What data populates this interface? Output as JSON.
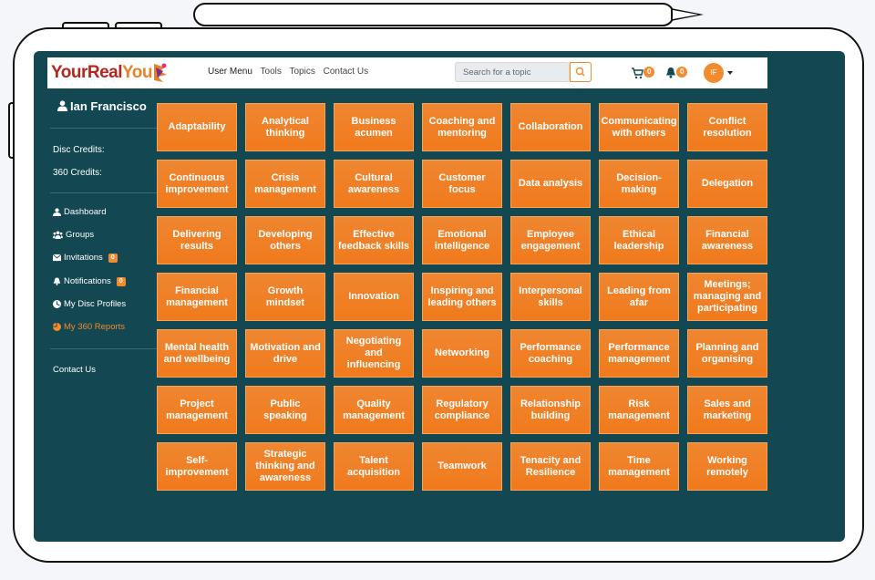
{
  "brand": {
    "part1": "YourReal",
    "part2": "You"
  },
  "nav": {
    "items": [
      "User Menu",
      "Tools",
      "Topics",
      "Contact Us"
    ]
  },
  "search": {
    "placeholder": "Search for a topic"
  },
  "header": {
    "cart_count": "0",
    "notification_count": "0",
    "avatar_initials": "IF"
  },
  "sidebar": {
    "user_name": "Ian Francisco",
    "disc_credits_label": "Disc Credits:",
    "credits360_label": "360 Credits:",
    "menu": [
      {
        "label": "Dashboard",
        "icon": "user-icon"
      },
      {
        "label": "Groups",
        "icon": "users-icon"
      },
      {
        "label": "Invitations",
        "icon": "envelope-icon",
        "badge": "0"
      },
      {
        "label": "Notifications",
        "icon": "bell-icon",
        "badge": "0"
      },
      {
        "label": "My Disc Profiles",
        "icon": "disc-icon"
      },
      {
        "label": "My 360 Reports",
        "icon": "pie-chart-icon",
        "active": true
      }
    ],
    "contact_label": "Contact Us"
  },
  "topics": [
    "Adaptability",
    "Analytical thinking",
    "Business acumen",
    "Coaching and mentoring",
    "Collaboration",
    "Communicating with others",
    "Conflict resolution",
    "Continuous improvement",
    "Crisis management",
    "Cultural awareness",
    "Customer focus",
    "Data analysis",
    "Decision-making",
    "Delegation",
    "Delivering results",
    "Developing others",
    "Effective feedback skills",
    "Emotional intelligence",
    "Employee engagement",
    "Ethical leadership",
    "Financial awareness",
    "Financial management",
    "Growth mindset",
    "Innovation",
    "Inspiring and leading others",
    "Interpersonal skills",
    "Leading from afar",
    "Meetings; managing and participating",
    "Mental health and wellbeing",
    "Motivation and drive",
    "Negotiating and influencing",
    "Networking",
    "Performance coaching",
    "Performance management",
    "Planning and organising",
    "Project management",
    "Public speaking",
    "Quality management",
    "Regulatory compliance",
    "Relationship building",
    "Risk management",
    "Sales and marketing",
    "Self-improvement",
    "Strategic thinking and awareness",
    "Talent acquisition",
    "Teamwork",
    "Tenacity and Resilience",
    "Time management",
    "Working remotely"
  ],
  "colors": {
    "accent": "#f07a1c",
    "screen_bg": "#134752",
    "active_menu": "#f28a2e"
  }
}
